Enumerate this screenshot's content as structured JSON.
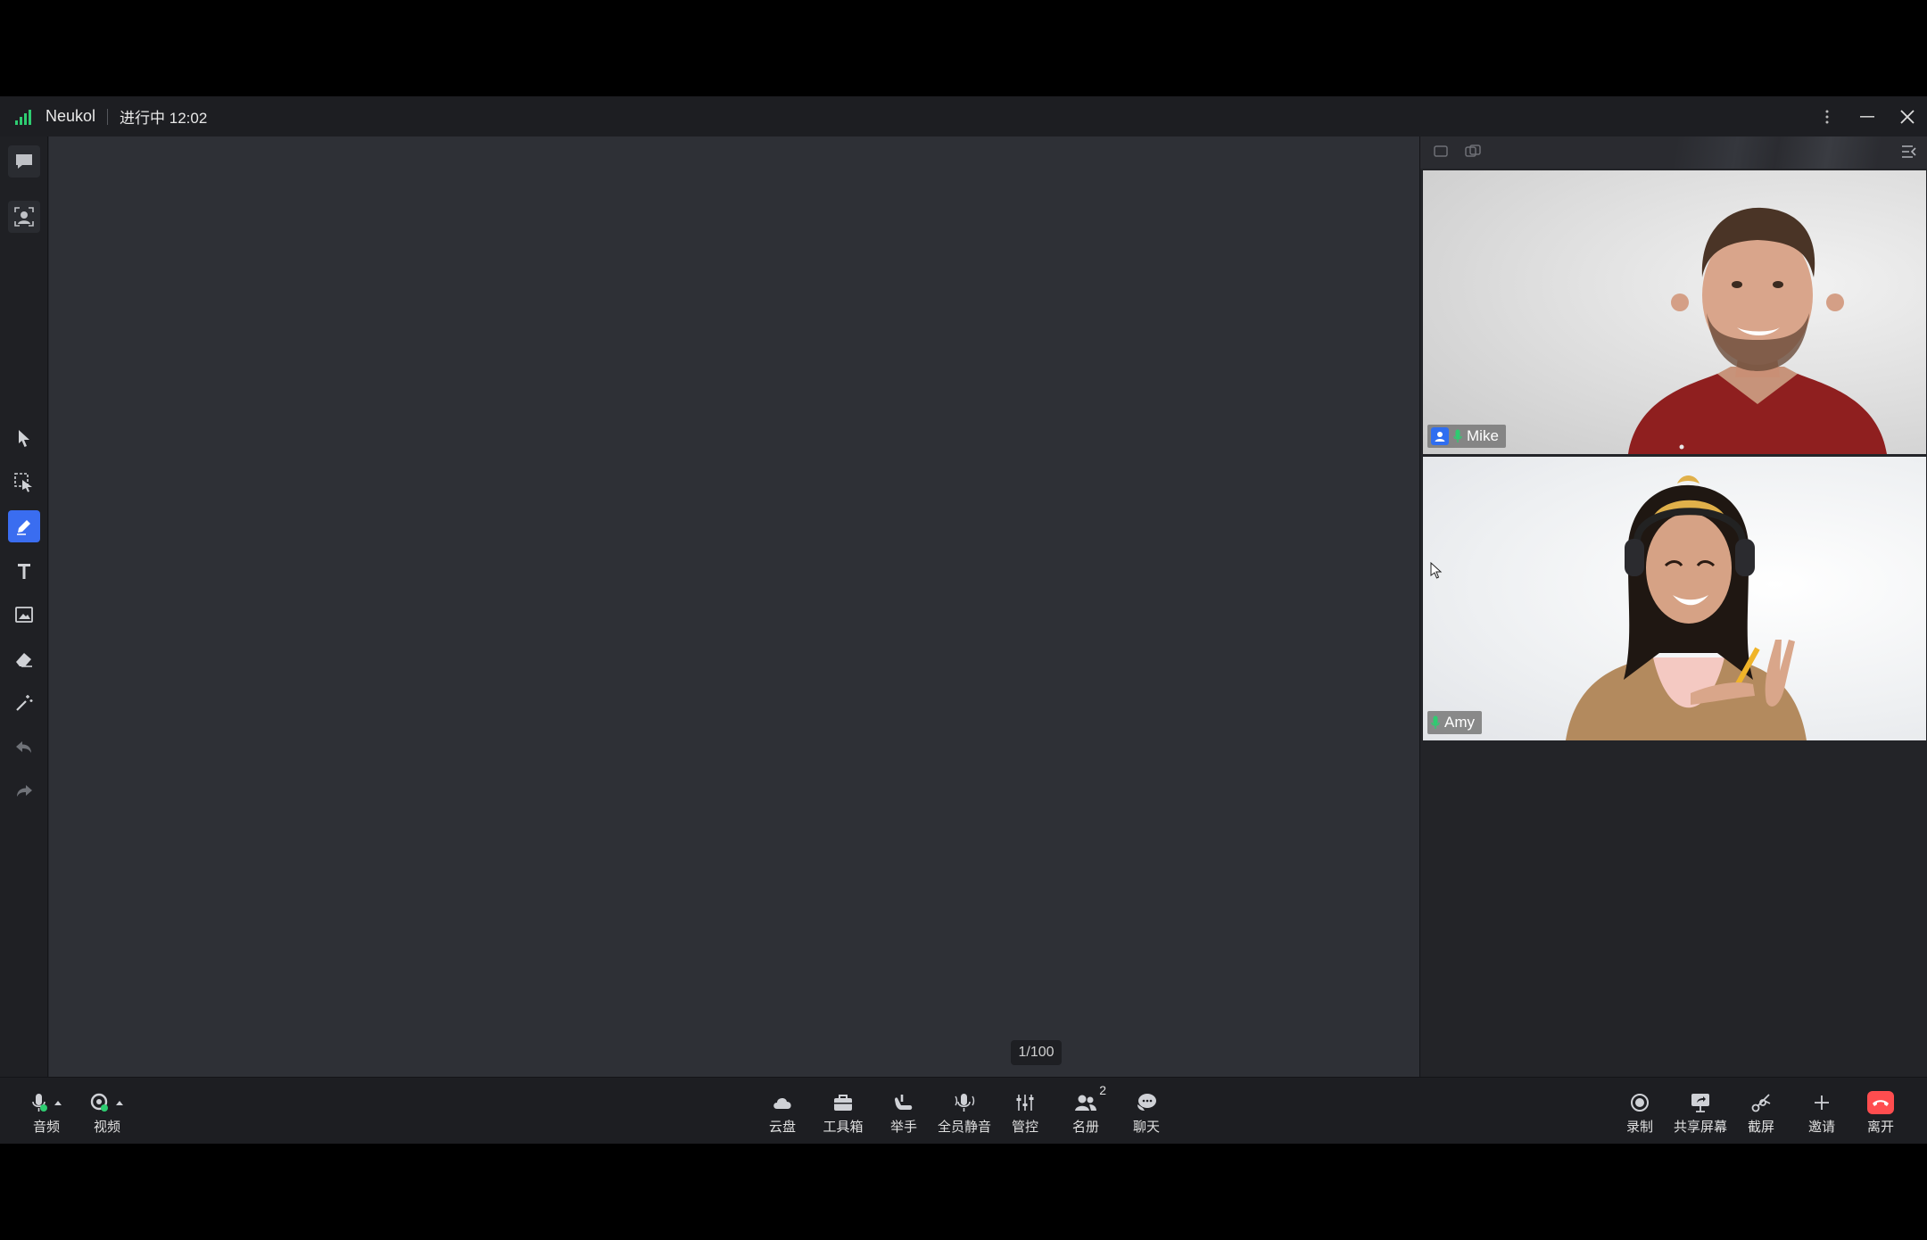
{
  "titlebar": {
    "app_name": "Neukol",
    "status": "进行中 12:02",
    "signal_color": "#2ecc71"
  },
  "left_toolbar": {
    "top_icons": [
      "chat-bubble-icon",
      "member-view-icon"
    ],
    "tools": [
      "select-arrow-icon",
      "region-select-icon",
      "pen-icon",
      "text-icon",
      "image-icon",
      "eraser-icon",
      "laser-pointer-icon",
      "undo-icon",
      "redo-icon"
    ],
    "active_tool": "pen-icon",
    "active_color": "#3a6df0"
  },
  "canvas": {
    "page_indicator": "1/100"
  },
  "participants": [
    {
      "name": "Mike",
      "is_host": true,
      "mic": "on"
    },
    {
      "name": "Amy",
      "is_host": false,
      "mic": "on"
    }
  ],
  "bottom_bar": {
    "left": [
      {
        "id": "audio",
        "label": "音频",
        "icon": "microphone-icon"
      },
      {
        "id": "video",
        "label": "视频",
        "icon": "camera-icon"
      }
    ],
    "center": [
      {
        "id": "cloud",
        "label": "云盘",
        "icon": "cloud-icon"
      },
      {
        "id": "toolbox",
        "label": "工具箱",
        "icon": "toolbox-icon"
      },
      {
        "id": "raise-hand",
        "label": "举手",
        "icon": "hand-icon"
      },
      {
        "id": "mute-all",
        "label": "全员静音",
        "icon": "mute-all-icon"
      },
      {
        "id": "control",
        "label": "管控",
        "icon": "sliders-icon"
      },
      {
        "id": "roster",
        "label": "名册",
        "icon": "people-icon",
        "badge": "2"
      },
      {
        "id": "chat",
        "label": "聊天",
        "icon": "chat-icon"
      }
    ],
    "right": [
      {
        "id": "record",
        "label": "录制",
        "icon": "record-icon"
      },
      {
        "id": "share-screen",
        "label": "共享屏幕",
        "icon": "share-screen-icon"
      },
      {
        "id": "screenshot",
        "label": "截屏",
        "icon": "scissors-icon"
      },
      {
        "id": "invite",
        "label": "邀请",
        "icon": "plus-icon"
      },
      {
        "id": "leave",
        "label": "离开",
        "icon": "hangup-icon",
        "color": "#ff4d4f"
      }
    ]
  }
}
